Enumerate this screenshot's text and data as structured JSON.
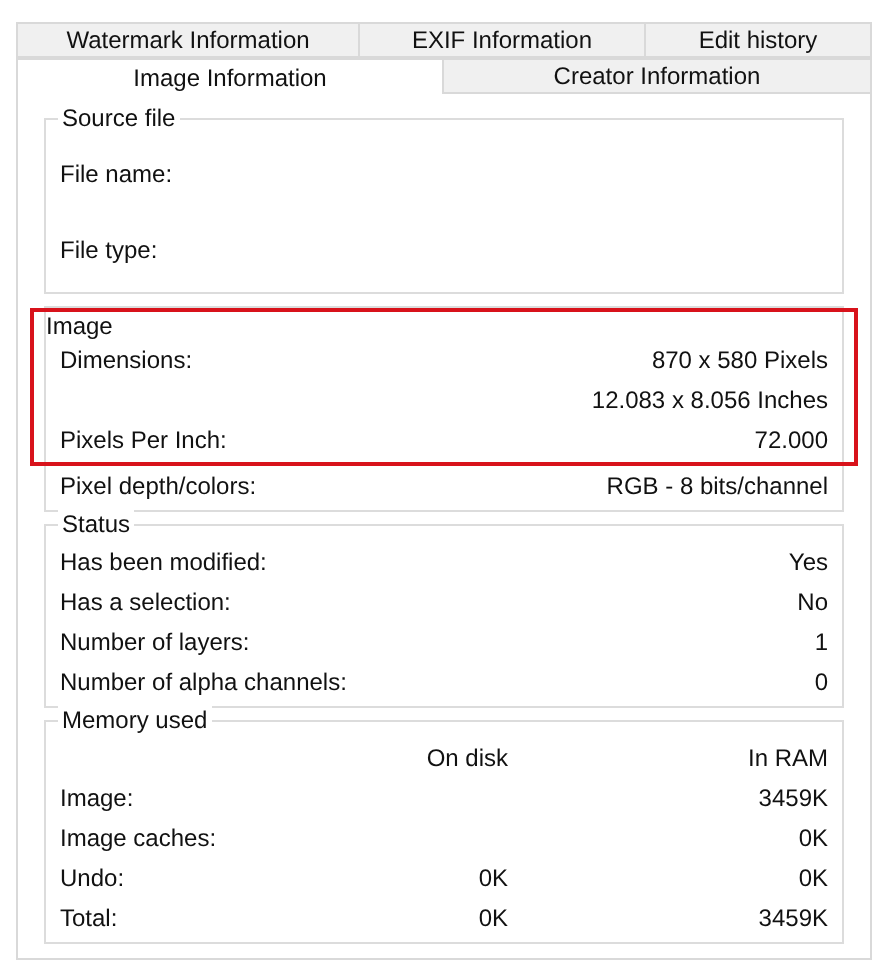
{
  "tab_rows": [
    [
      {
        "label": "Watermark Information",
        "selected": false
      },
      {
        "label": "EXIF Information",
        "selected": false
      },
      {
        "label": "Edit history",
        "selected": false
      }
    ],
    [
      {
        "label": "Image Information",
        "selected": true
      },
      {
        "label": "Creator Information",
        "selected": false
      }
    ]
  ],
  "sections": [
    {
      "kind": "fields",
      "title": "Source file",
      "highlighted": false,
      "rows": [
        {
          "label": "File name:"
        },
        {
          "label": "File type:"
        }
      ]
    },
    {
      "kind": "properties",
      "title": "Image",
      "highlighted": true,
      "rows": [
        {
          "label": "Dimensions:",
          "value": "870 x 580 Pixels"
        },
        {
          "value": "12.083 x 8.056 Inches"
        },
        {
          "label": "Pixels Per Inch:",
          "value": "72.000"
        }
      ],
      "extra_rows": [
        {
          "label": "Pixel depth/colors:",
          "value": "RGB - 8 bits/channel"
        }
      ]
    },
    {
      "kind": "properties",
      "title": "Status",
      "highlighted": false,
      "rows": [
        {
          "label": "Has been modified:",
          "value": "Yes"
        },
        {
          "label": "Has a selection:",
          "value": "No"
        },
        {
          "label": "Number of layers:",
          "value": "1"
        },
        {
          "label": "Number of alpha channels:",
          "value": "0"
        }
      ]
    },
    {
      "kind": "memory",
      "title": "Memory used",
      "highlighted": false,
      "columns": [
        "On disk",
        "In RAM"
      ],
      "rows": [
        {
          "label": "Image:",
          "in_ram": "3459K"
        },
        {
          "label": "Image caches:",
          "in_ram": "0K"
        },
        {
          "label": "Undo:",
          "on_disk": "0K",
          "in_ram": "0K"
        },
        {
          "label": "Total:",
          "on_disk": "0K",
          "in_ram": "3459K"
        }
      ]
    }
  ]
}
